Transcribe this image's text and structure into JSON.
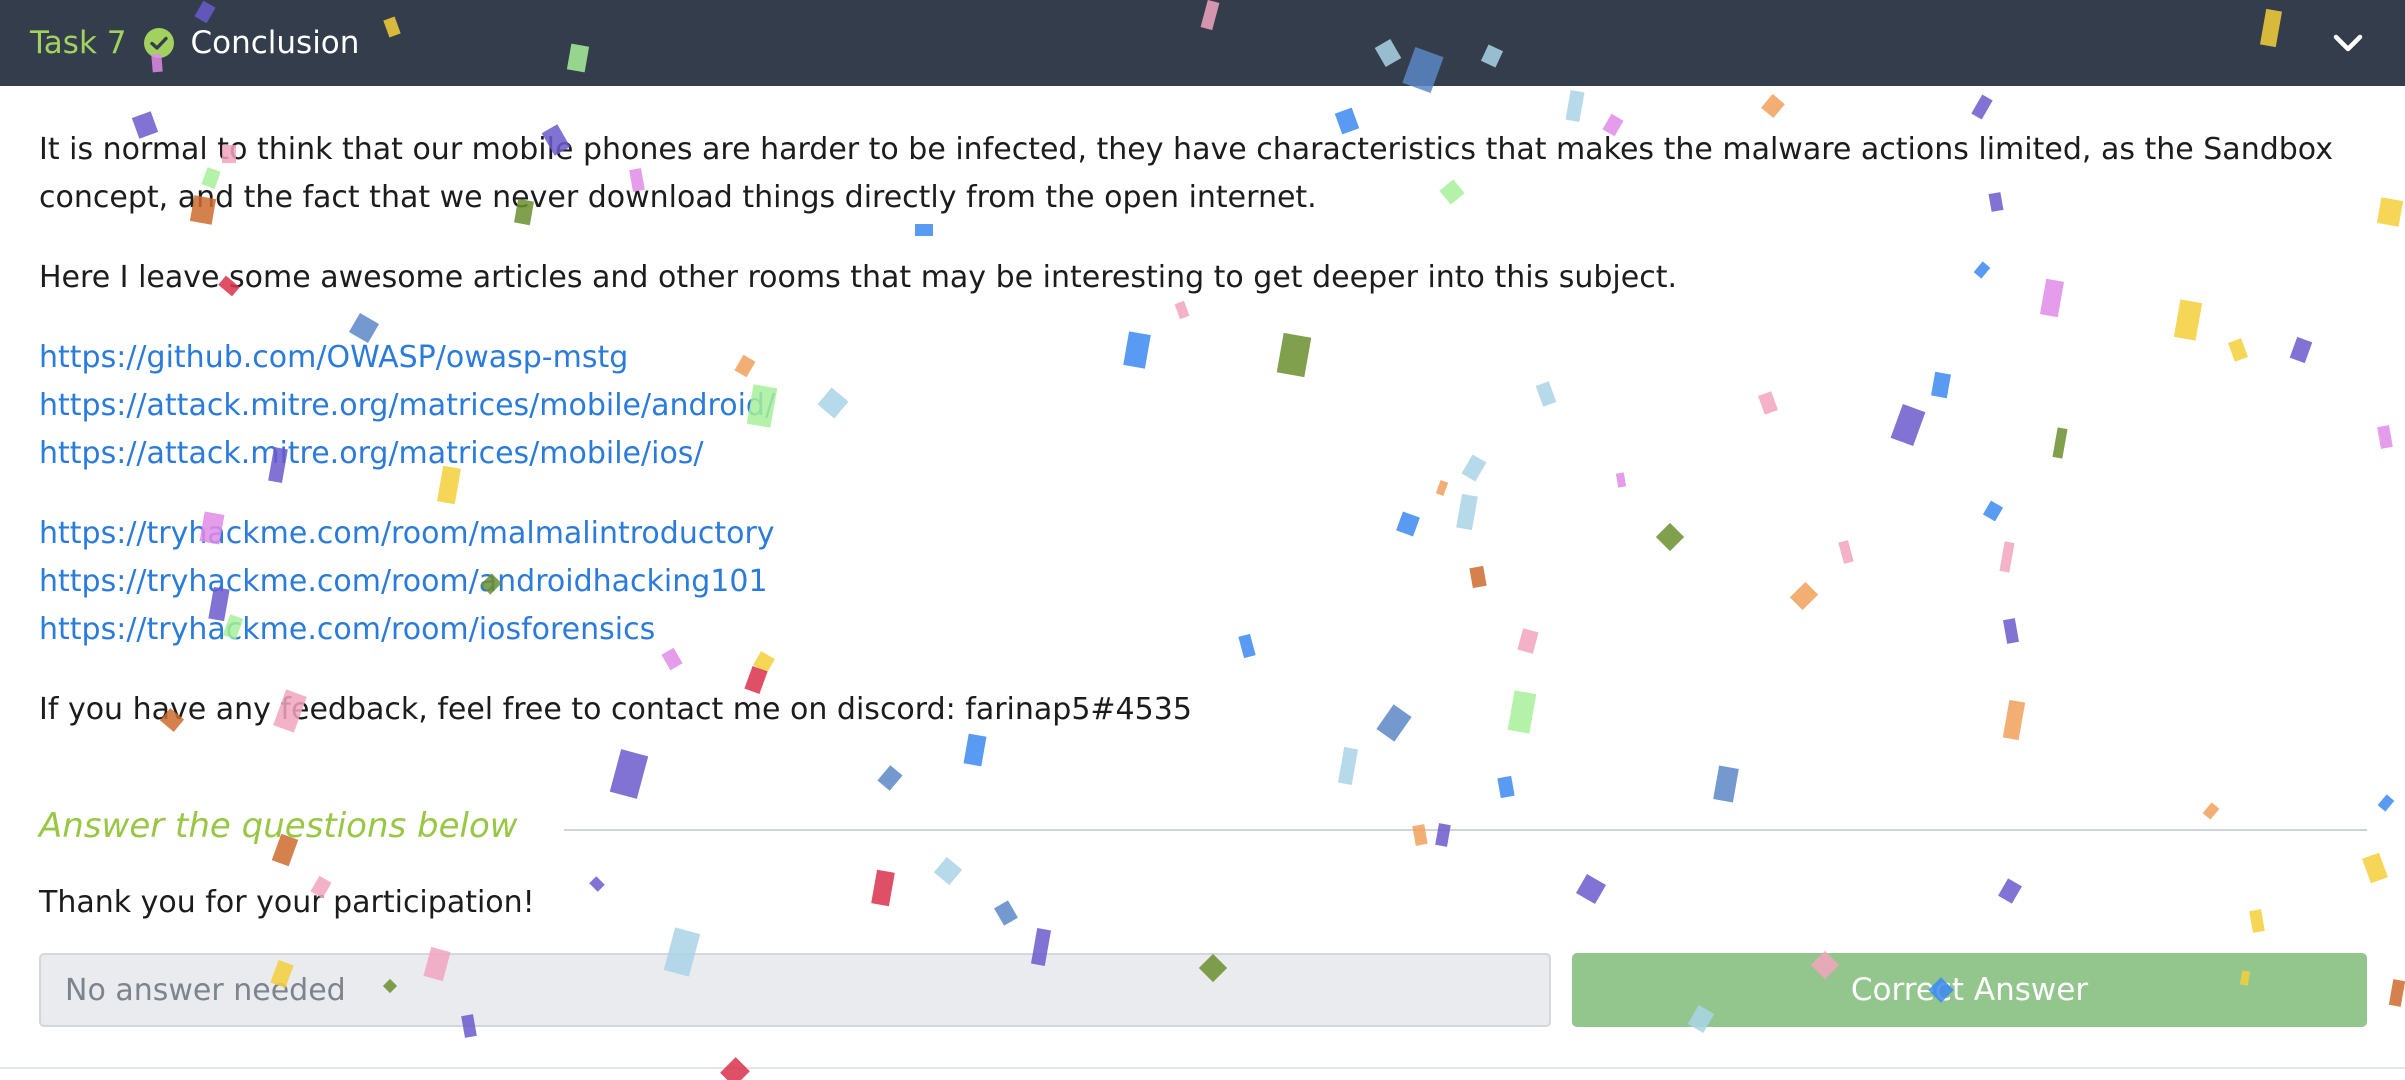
{
  "task": {
    "number_label": "Task 7",
    "title": "Conclusion"
  },
  "body": {
    "paragraph1": "It is normal to think that our mobile phones are harder to be infected, they have characteristics that makes the malware actions limited, as the Sandbox concept, and the fact that we never download things directly from the open internet.",
    "paragraph2": "Here I leave some awesome articles and other rooms that may be interesting to get deeper into this subject.",
    "links_articles": [
      "https://github.com/OWASP/owasp-mstg",
      "https://attack.mitre.org/matrices/mobile/android/",
      "https://attack.mitre.org/matrices/mobile/ios/"
    ],
    "links_rooms": [
      "https://tryhackme.com/room/malmalintroductory",
      "https://tryhackme.com/room/androidhacking101",
      "https://tryhackme.com/room/iosforensics"
    ],
    "feedback": "If you have any feedback, feel free to contact me on discord: farinap5#4535"
  },
  "questions": {
    "heading": "Answer the questions below",
    "question1": "Thank you for your participation!",
    "answer_value": "No answer needed",
    "submit_label": "Correct Answer"
  },
  "colors": {
    "header_bg": "#343d4b",
    "task_accent": "#a3d160",
    "link": "#2b7bdc",
    "heading_accent": "#98c744",
    "correct_button": "#93c68c"
  },
  "icons": {
    "status": "check-circle-icon",
    "toggle": "chevron-down-icon"
  }
}
